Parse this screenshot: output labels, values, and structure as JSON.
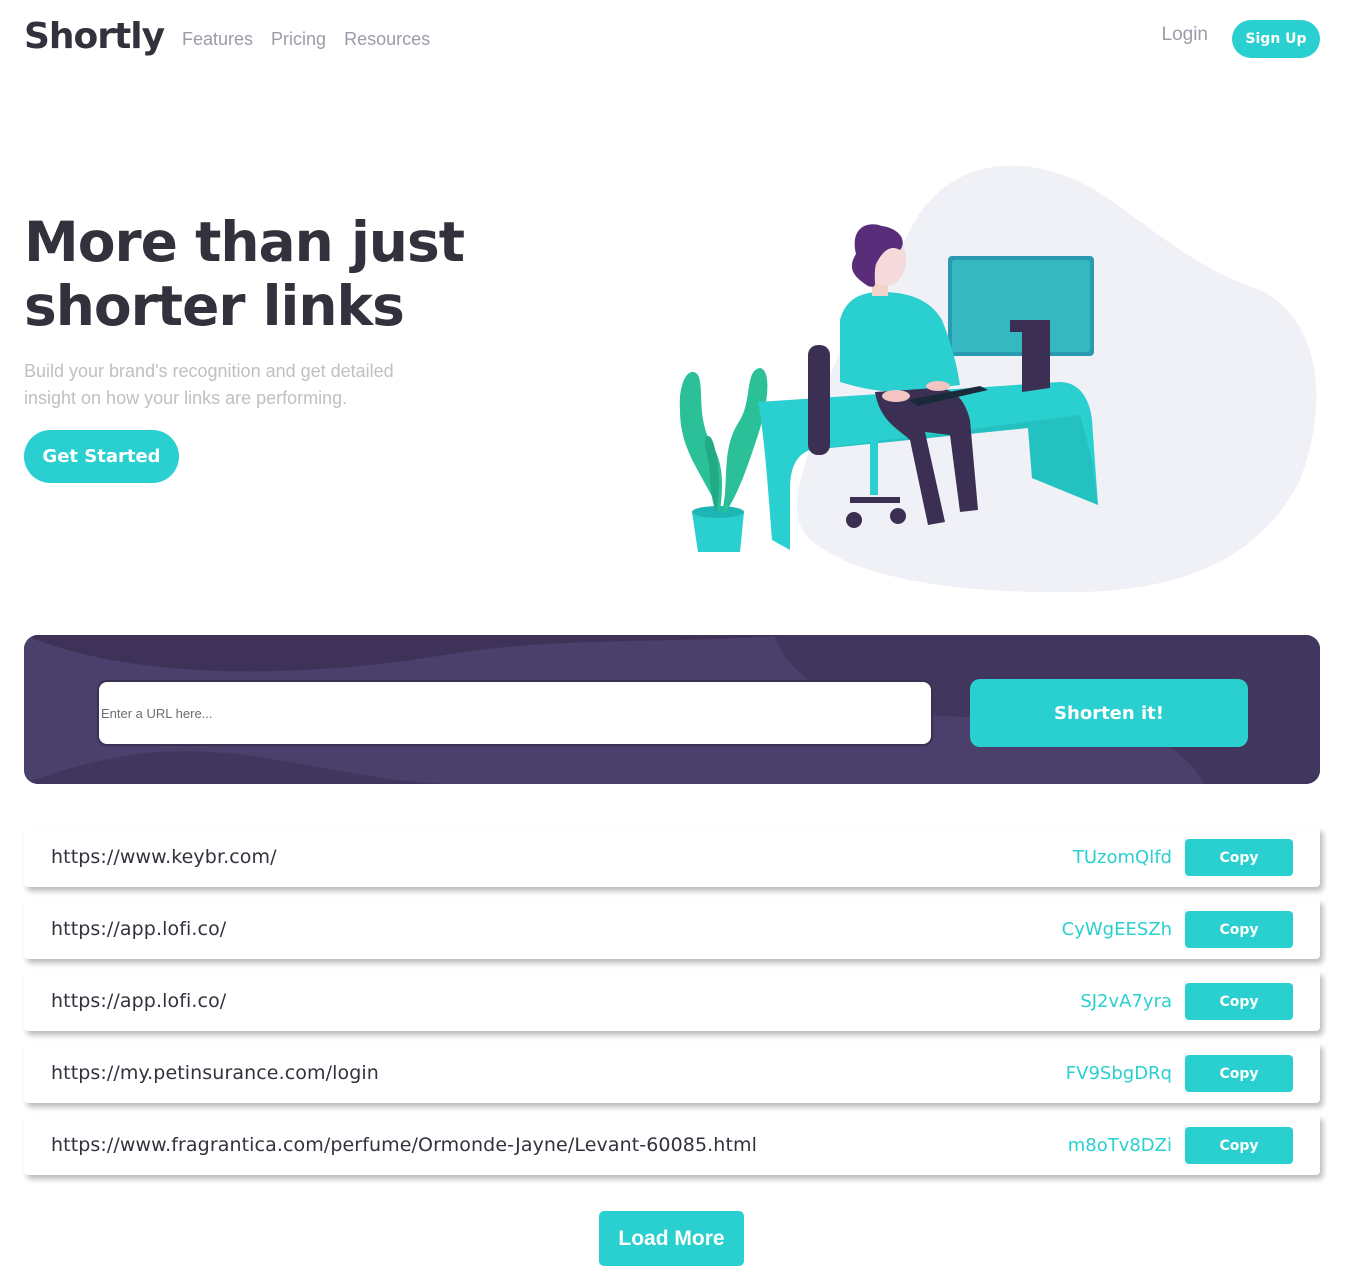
{
  "header": {
    "logo": "Shortly",
    "nav": [
      {
        "label": "Features"
      },
      {
        "label": "Pricing"
      },
      {
        "label": "Resources"
      }
    ],
    "login_label": "Login",
    "signup_label": "Sign Up"
  },
  "hero": {
    "title_line1": "More than just",
    "title_line2": "shorter links",
    "subtitle_line1": "Build your brand's recognition and get detailed",
    "subtitle_line2": "insight on how your links are performing.",
    "cta_label": "Get Started"
  },
  "shorten": {
    "placeholder": "Enter a URL here...",
    "value": "",
    "button_label": "Shorten it!"
  },
  "results": [
    {
      "original": "https://www.keybr.com/",
      "short": "TUzomQlfd",
      "copy_label": "Copy"
    },
    {
      "original": "https://app.lofi.co/",
      "short": "CyWgEESZh",
      "copy_label": "Copy"
    },
    {
      "original": "https://app.lofi.co/",
      "short": "SJ2vA7yra",
      "copy_label": "Copy"
    },
    {
      "original": "https://my.petinsurance.com/login",
      "short": "FV9SbgDRq",
      "copy_label": "Copy"
    },
    {
      "original": "https://www.fragrantica.com/perfume/Ormonde-Jayne/Levant-60085.html",
      "short": "m8oTv8DZi",
      "copy_label": "Copy"
    }
  ],
  "load_more_label": "Load More",
  "colors": {
    "accent": "#2acfcf",
    "dark_violet": "#3b3054",
    "panel": "#4b3f6b",
    "text_dark": "#34313d",
    "text_gray": "#9e9aa7"
  },
  "illustration": {
    "icon": "person-working-at-desk-illustration"
  }
}
